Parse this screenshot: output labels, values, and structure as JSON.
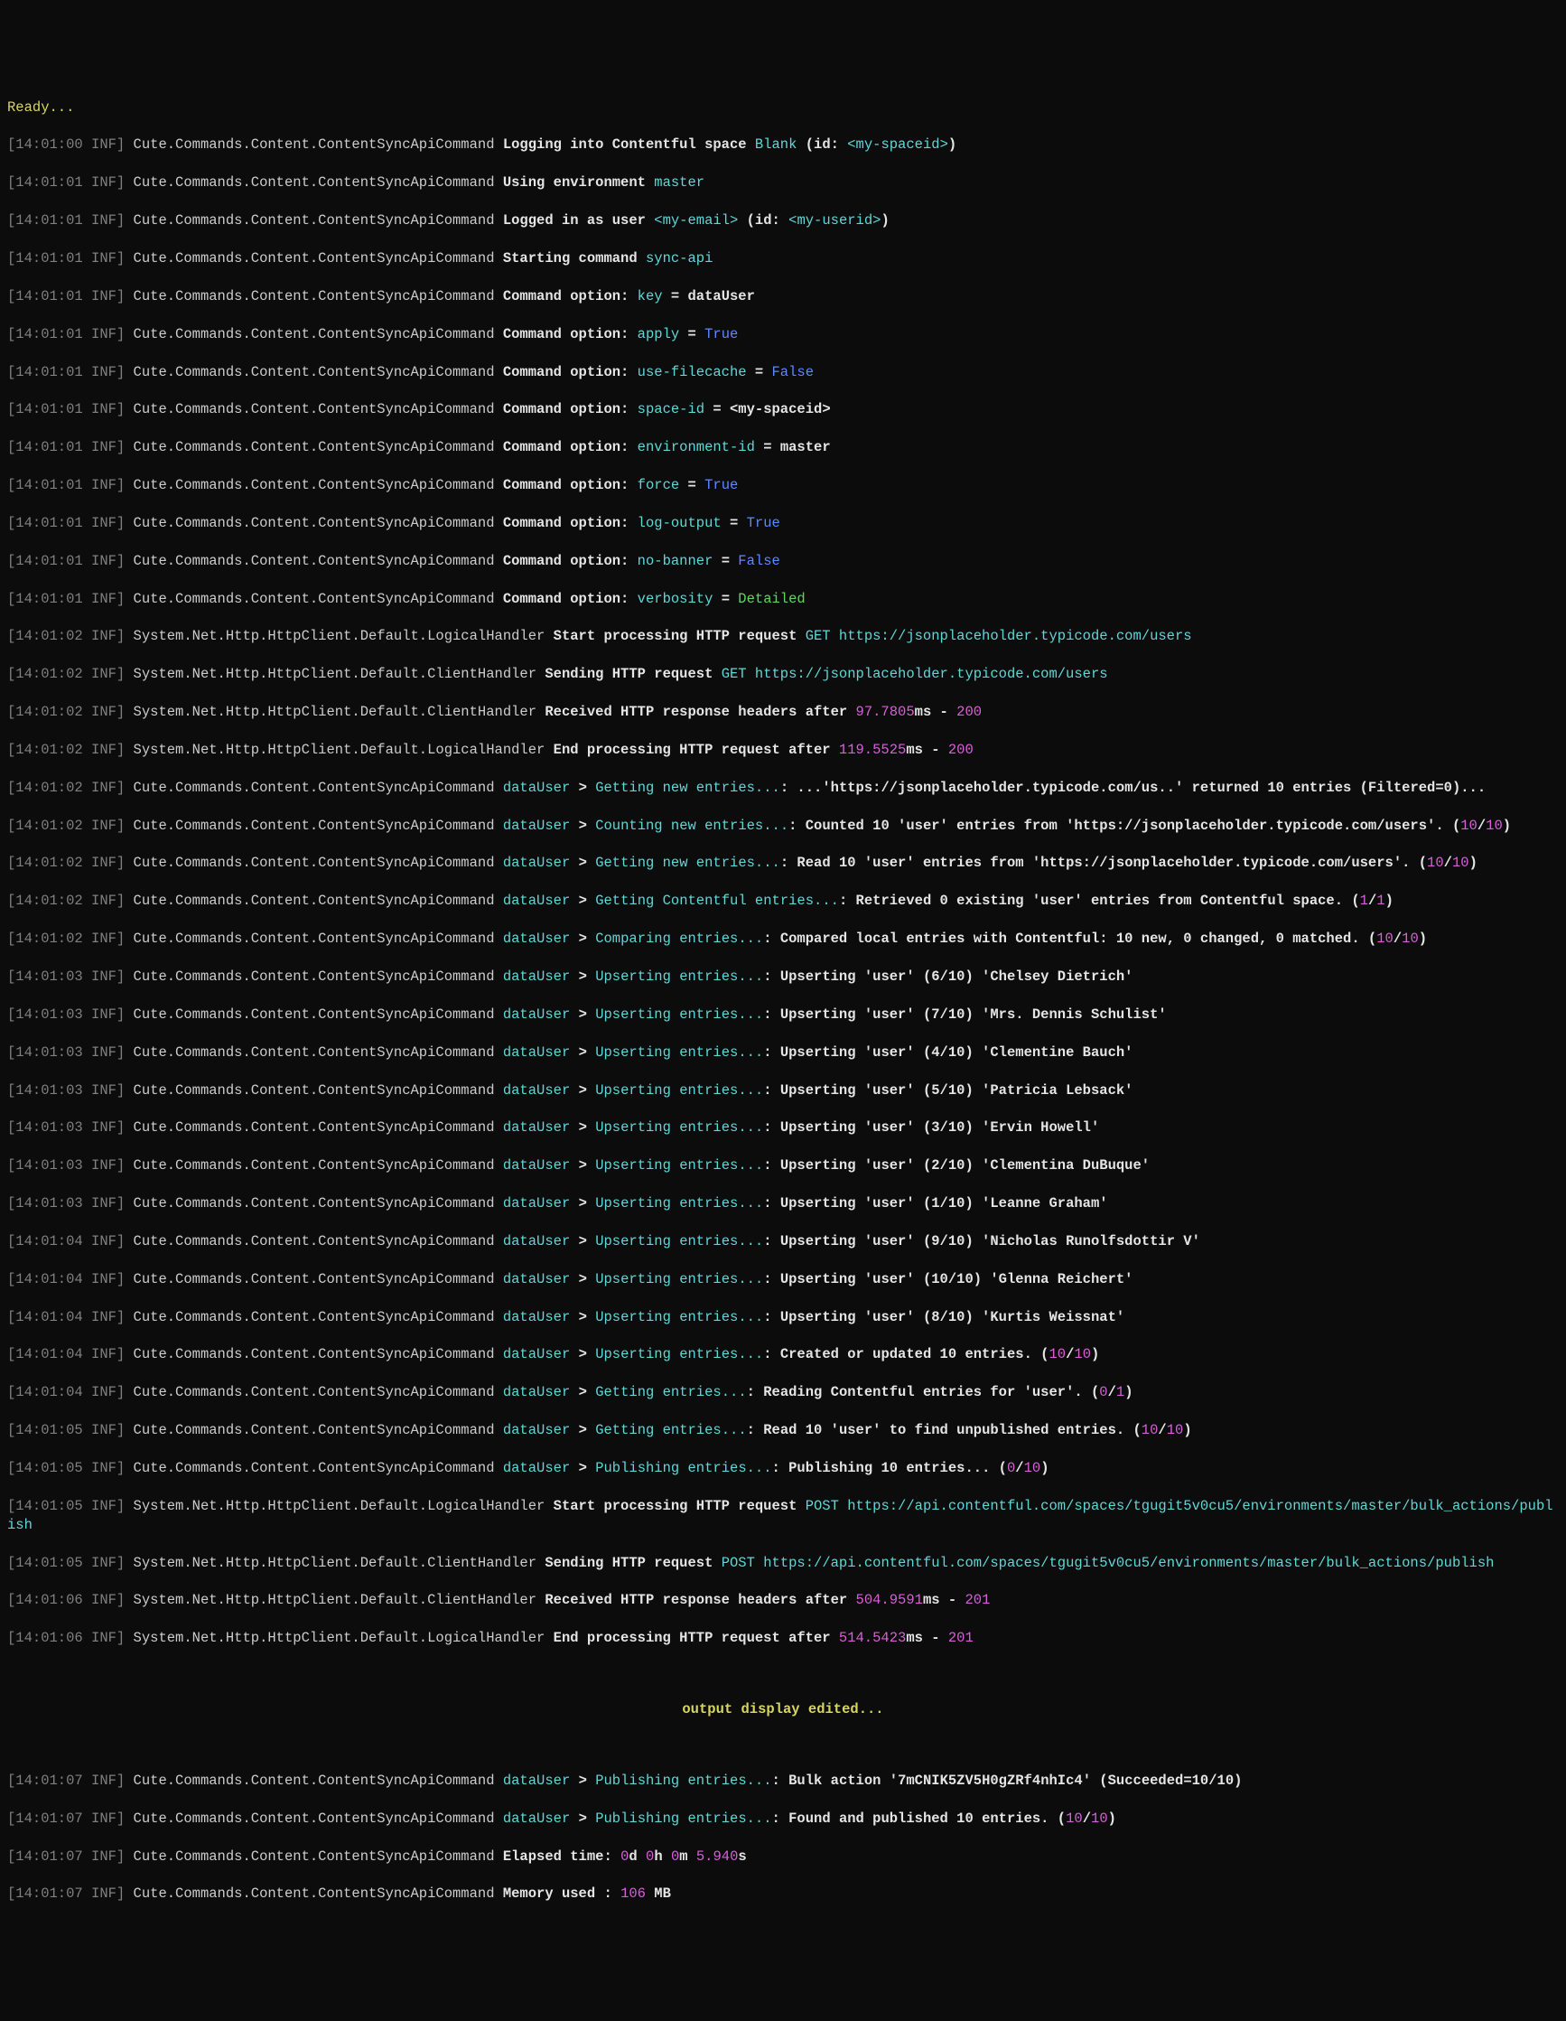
{
  "c": {
    "ready": "Ready...",
    "source": "Cute.Commands.Content.ContentSyncApiCommand",
    "httpLogical": "System.Net.Http.HttpClient.Default.LogicalHandler",
    "httpClient": "System.Net.Http.HttpClient.Default.ClientHandler",
    "url_users": "https://jsonplaceholder.typicode.com/users",
    "url_publish": "https://api.contentful.com/spaces/tgugit5v0cu5/environments/master/bulk_actions/publish",
    "spaceName": "Blank",
    "spaceId": "<my-spaceid>",
    "email": "<my-email>",
    "userId": "<my-userid>",
    "envMaster": "master",
    "cmdName": "sync-api",
    "dataUser": "dataUser",
    "editedMsg": "output display edited...",
    "bulkActionId": "7mCNIK5ZV5H0gZRf4nhIc4",
    "ts00": "[14:01:00 INF]",
    "ts01": "[14:01:01 INF]",
    "ts02": "[14:01:02 INF]",
    "ts03": "[14:01:03 INF]",
    "ts04": "[14:01:04 INF]",
    "ts05": "[14:01:05 INF]",
    "ts06": "[14:01:06 INF]",
    "ts07": "[14:01:07 INF]"
  },
  "txt": {
    "loggingInto": "Logging into Contentful space",
    "id_open": "(id:",
    "close_paren": ")",
    "usingEnv": "Using environment",
    "loggedInAs": "Logged in as user",
    "startingCmd": "Starting command",
    "cmdOption": "Command option:",
    "startProcHttp": "Start processing HTTP request",
    "sendingHttp": "Sending HTTP request",
    "receivedHttp": "Received HTTP response headers after",
    "endProcHttp": "End processing HTTP request after",
    "ms_dash": "ms -",
    "gt": ">",
    "upserting": "Upserting entries...",
    "gettingNewDots": "Getting new entries...",
    "countingNew": "Counting new entries...",
    "gettingCf": "Getting Contentful entries...",
    "comparing": "Comparing entries...",
    "gettingEntries": "Getting entries...",
    "publishing": "Publishing entries...",
    "elapsed": "Elapsed time:",
    "memUsed": "Memory used :",
    "GET": "GET",
    "POST": "POST"
  },
  "opts": {
    "key_lbl": "key",
    "key_val": "dataUser",
    "apply_lbl": "apply",
    "apply_val": "True",
    "fc_lbl": "use-filecache",
    "fc_val": "False",
    "space_lbl": "space-id",
    "space_val": "<my-spaceid>",
    "env_lbl": "environment-id",
    "env_val": "master",
    "force_lbl": "force",
    "force_val": "True",
    "log_lbl": "log-output",
    "log_val": "True",
    "banner_lbl": "no-banner",
    "banner_val": "False",
    "verb_lbl": "verbosity",
    "verb_val": "Detailed"
  },
  "http": {
    "t1": "97.7805",
    "s1": "200",
    "t2": "119.5525",
    "s2": "200",
    "t3": "504.9591",
    "s3": "201",
    "t4": "514.5423",
    "s4": "201"
  },
  "msgs": {
    "getNew1a": ": ...'https://jsonplaceholder.typicode.com/us..' returned 10 entries (Filtered=0)...",
    "countNew": ": Counted 10 'user' entries from 'https://jsonplaceholder.typicode.com/users'. (",
    "getNew2": ": Read 10 'user' entries from 'https://jsonplaceholder.typicode.com/users'. (",
    "getCf": ": Retrieved 0 existing 'user' entries from Contentful space. (",
    "compare": ": Compared local entries with Contentful: 10 new, 0 changed, 0 matched. (",
    "upsertDone": ": Created or updated 10 entries. (",
    "getEntries1": ": Reading Contentful entries for 'user'. (",
    "getEntries2": ": Read 10 'user' to find unpublished entries. (",
    "pub1a": ": Publishing 10 entries... (",
    "pub2a": ": Bulk action '",
    "pub2b": "' (Succeeded=10/10)",
    "pub3a": ": Found and published 10 entries. (",
    "n10": "10",
    "n1": "1",
    "n0": "0",
    "slash": "/",
    "cp": ")"
  },
  "users": {
    "u6": ": Upserting 'user' (6/10) 'Chelsey Dietrich'",
    "u7": ": Upserting 'user' (7/10) 'Mrs. Dennis Schulist'",
    "u4": ": Upserting 'user' (4/10) 'Clementine Bauch'",
    "u5": ": Upserting 'user' (5/10) 'Patricia Lebsack'",
    "u3": ": Upserting 'user' (3/10) 'Ervin Howell'",
    "u2": ": Upserting 'user' (2/10) 'Clementina DuBuque'",
    "u1": ": Upserting 'user' (1/10) 'Leanne Graham'",
    "u9": ": Upserting 'user' (9/10) 'Nicholas Runolfsdottir V'",
    "u10": ": Upserting 'user' (10/10) 'Glenna Reichert'",
    "u8": ": Upserting 'user' (8/10) 'Kurtis Weissnat'"
  },
  "elapsed": {
    "d": "0",
    "h": "0",
    "m": "0",
    "s": "5.940",
    "dl": "d",
    "hl": "h",
    "ml": "m",
    "sl": "s"
  },
  "mem": {
    "val": "106",
    "unit": "MB"
  },
  "eq": " = "
}
